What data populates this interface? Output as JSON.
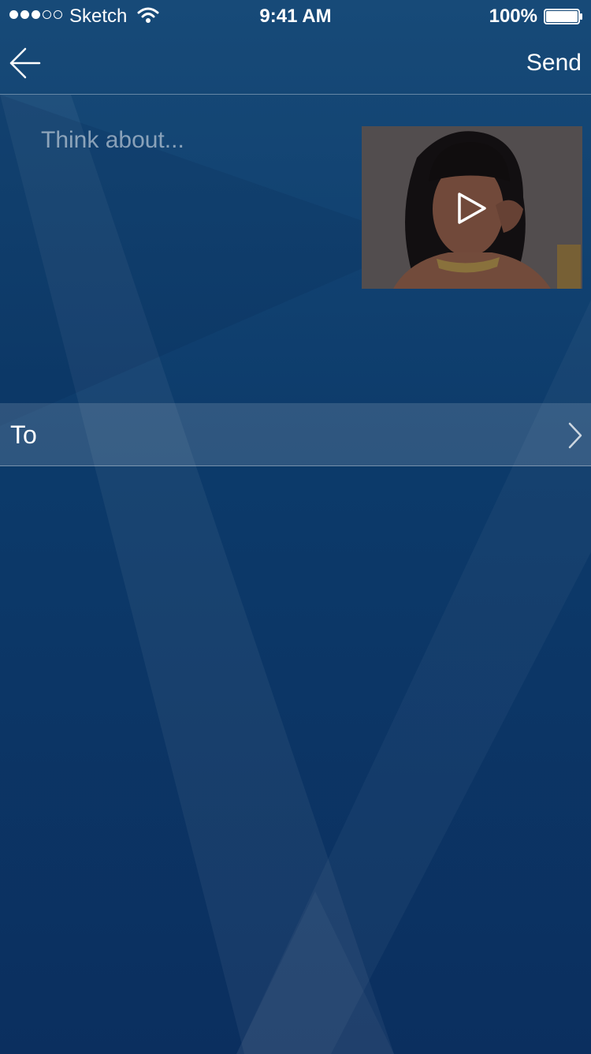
{
  "status_bar": {
    "signal_filled": 3,
    "signal_total": 5,
    "carrier": "Sketch",
    "time": "9:41 AM",
    "battery_percent": "100%",
    "battery_level": 1.0
  },
  "nav": {
    "back_icon": "arrow-left-icon",
    "send_label": "Send"
  },
  "compose": {
    "placeholder": "Think about...",
    "value": "",
    "attachment": {
      "type": "video",
      "play_icon": "play-icon"
    }
  },
  "recipients": {
    "label": "To",
    "chevron_icon": "chevron-right-icon"
  },
  "colors": {
    "background_top": "#174a78",
    "background_bottom": "#0b2f5f",
    "text": "#ffffff",
    "row_highlight": "rgba(255,255,255,0.14)",
    "divider": "rgba(255,255,255,0.35)"
  }
}
